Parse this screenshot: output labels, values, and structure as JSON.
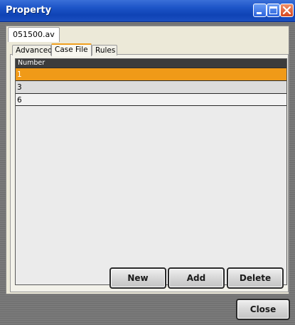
{
  "window": {
    "title": "Property"
  },
  "file_tab": {
    "label": "051500.av"
  },
  "tabs": [
    {
      "label": "Advanced",
      "active": false
    },
    {
      "label": "Case File",
      "active": true
    },
    {
      "label": "Rules",
      "active": false
    }
  ],
  "table": {
    "header": "Number",
    "rows": [
      {
        "value": "1",
        "selected": true
      },
      {
        "value": "3",
        "selected": false
      },
      {
        "value": "6",
        "selected": false
      }
    ]
  },
  "buttons": {
    "new": "New",
    "add": "Add",
    "delete": "Delete",
    "close": "Close"
  },
  "colors": {
    "selection": "#f09a18",
    "titlebar": "#1d55c8"
  }
}
